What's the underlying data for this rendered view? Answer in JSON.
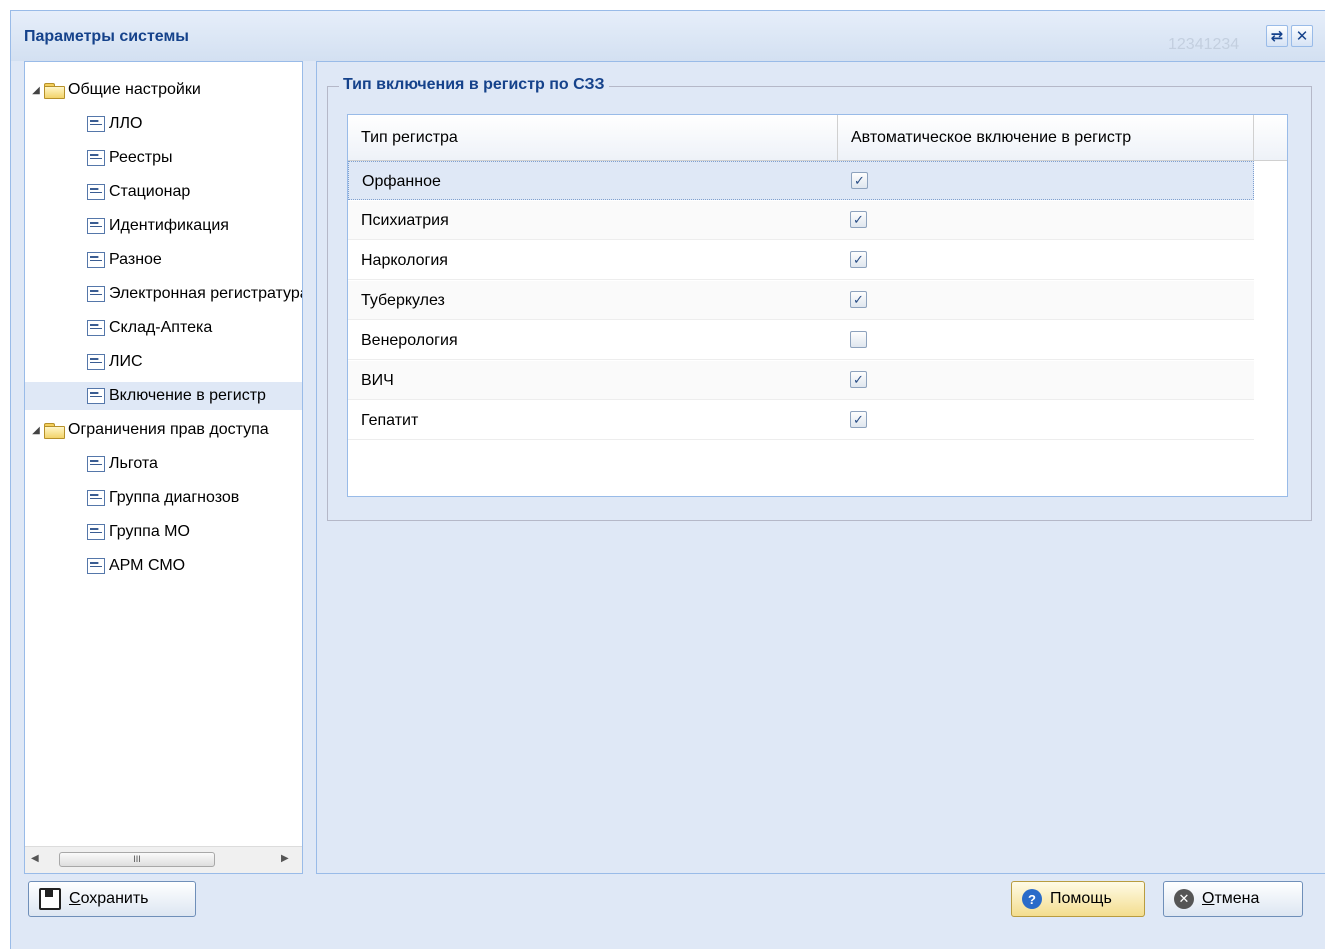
{
  "window": {
    "title": "Параметры системы",
    "background_text": "12341234"
  },
  "tree": {
    "nodes": [
      {
        "label": "Общие настройки",
        "type": "folder",
        "expanded": true
      },
      {
        "label": "ЛЛО",
        "type": "leaf"
      },
      {
        "label": "Реестры",
        "type": "leaf"
      },
      {
        "label": "Стационар",
        "type": "leaf"
      },
      {
        "label": "Идентификация",
        "type": "leaf"
      },
      {
        "label": "Разное",
        "type": "leaf"
      },
      {
        "label": "Электронная регистратура",
        "type": "leaf"
      },
      {
        "label": "Склад-Аптека",
        "type": "leaf"
      },
      {
        "label": "ЛИС",
        "type": "leaf"
      },
      {
        "label": "Включение в регистр",
        "type": "leaf",
        "selected": true
      },
      {
        "label": "Ограничения прав доступа",
        "type": "folder",
        "expanded": true
      },
      {
        "label": "Льгота",
        "type": "leaf"
      },
      {
        "label": "Группа диагнозов",
        "type": "leaf"
      },
      {
        "label": "Группа МО",
        "type": "leaf"
      },
      {
        "label": "АРМ СМО",
        "type": "leaf"
      }
    ],
    "scrollbar_thumb": "III"
  },
  "fieldset": {
    "legend": "Тип включения в регистр по СЗЗ"
  },
  "grid": {
    "columns": [
      "Тип регистра",
      "Автоматическое включение в регистр"
    ],
    "rows": [
      {
        "name": "Орфанное",
        "checked": true
      },
      {
        "name": "Психиатрия",
        "checked": true
      },
      {
        "name": "Наркология",
        "checked": true
      },
      {
        "name": "Туберкулез",
        "checked": true
      },
      {
        "name": "Венерология",
        "checked": false
      },
      {
        "name": "ВИЧ",
        "checked": true
      },
      {
        "name": "Гепатит",
        "checked": true
      }
    ]
  },
  "buttons": {
    "save": {
      "first": "С",
      "rest": "охранить"
    },
    "help": {
      "label": "Помощь"
    },
    "cancel": {
      "first": "О",
      "rest": "тмена"
    }
  },
  "colors": {
    "accent": "#15428b",
    "panel": "#dfe8f6",
    "border": "#99bbe8"
  }
}
